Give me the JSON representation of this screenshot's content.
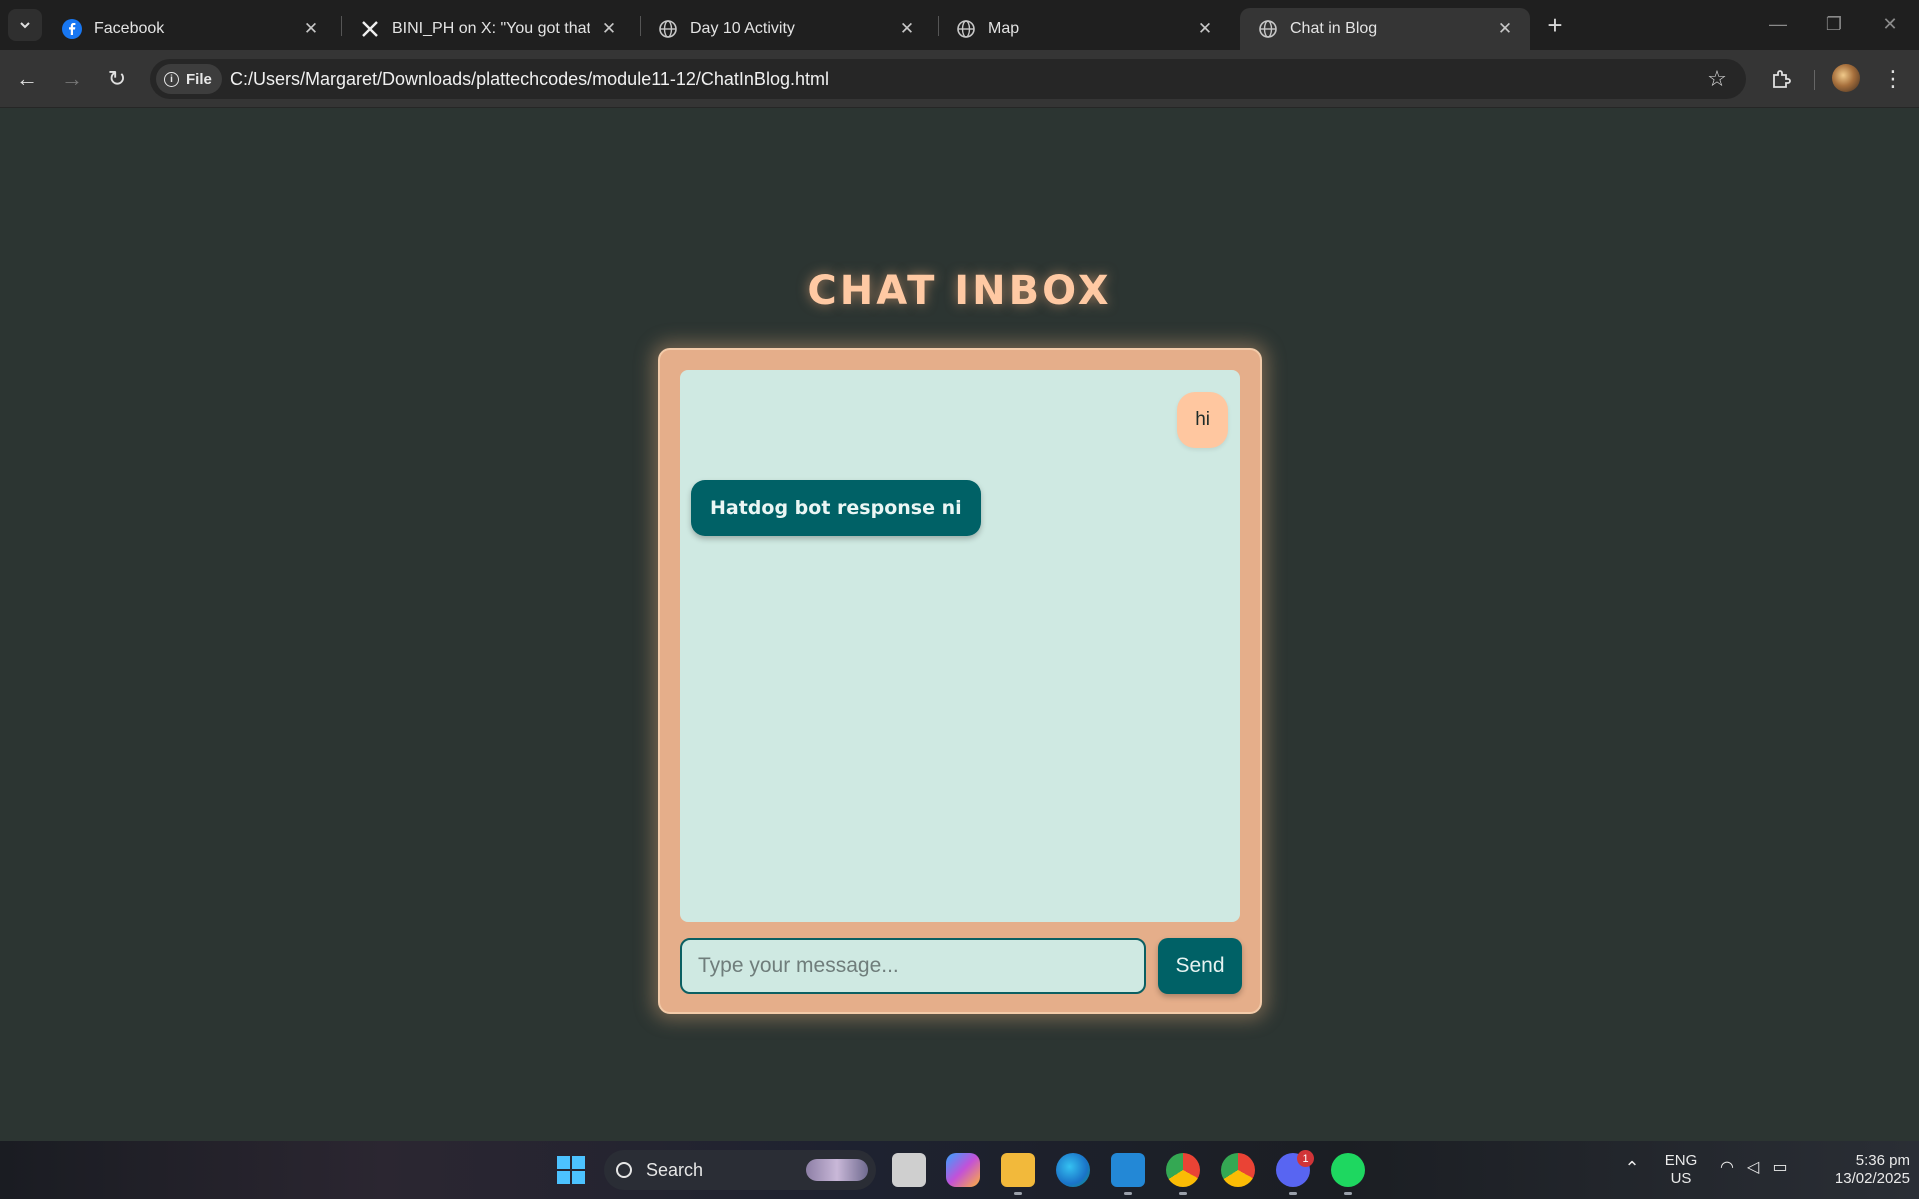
{
  "browser": {
    "tabs": [
      {
        "title": "Facebook",
        "icon": "facebook-icon"
      },
      {
        "title": "BINI_PH on X: \"You got that sym",
        "icon": "x-logo-icon"
      },
      {
        "title": "Day 10 Activity",
        "icon": "globe-icon"
      },
      {
        "title": "Map",
        "icon": "globe-icon"
      },
      {
        "title": "Chat in Blog",
        "icon": "globe-icon",
        "active": true
      }
    ],
    "address": {
      "scheme_chip": "File",
      "url": "C:/Users/Margaret/Downloads/plattechcodes/module11-12/ChatInBlog.html"
    }
  },
  "page": {
    "title": "CHAT INBOX",
    "messages": [
      {
        "sender": "user",
        "text": "hi"
      },
      {
        "sender": "bot",
        "text": "Hatdog bot response ni"
      }
    ],
    "input": {
      "placeholder": "Type your message...",
      "value": ""
    },
    "send_label": "Send"
  },
  "taskbar": {
    "search_label": "Search",
    "discord_badge": "1",
    "language": {
      "line1": "ENG",
      "line2": "US"
    },
    "clock": {
      "time": "5:36 pm",
      "date": "13/02/2025"
    }
  },
  "colors": {
    "page_bg": "#2c3532",
    "title": "#ffc9a3",
    "container": "#e5ae8a",
    "chat_bg": "#cfe9e2",
    "user_bubble": "#ffc7a0",
    "bot_bubble": "#006166",
    "send_button": "#006166"
  }
}
